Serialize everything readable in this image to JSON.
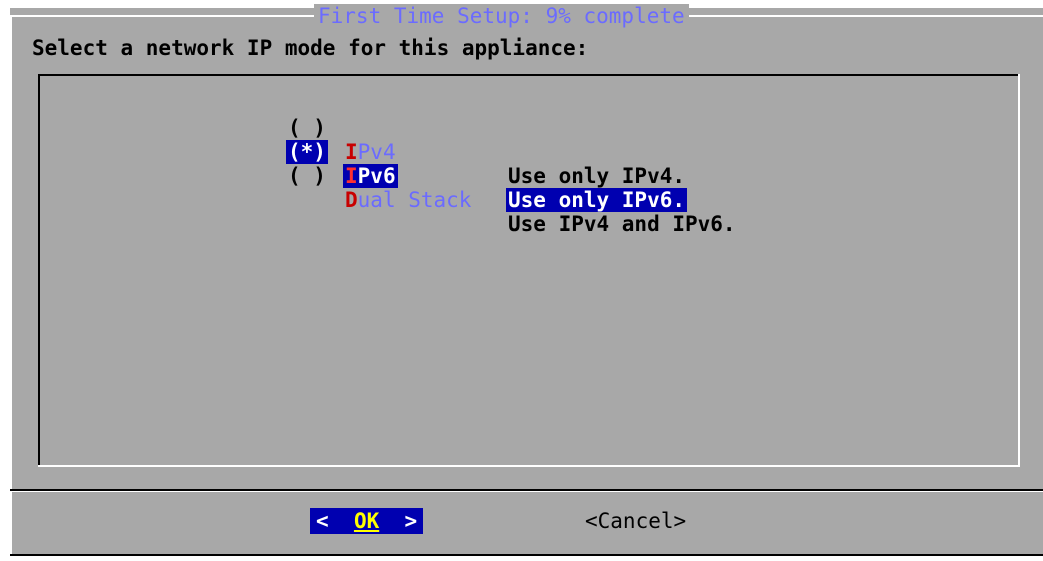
{
  "dialog": {
    "title": "First Time Setup: 9% complete",
    "prompt": "Select a network IP mode for this appliance:"
  },
  "options": [
    {
      "marker": "( )",
      "hotkey": "I",
      "rest": "Pv4",
      "description": "Use only IPv4.",
      "selected": false
    },
    {
      "marker": "(*)",
      "hotkey": "I",
      "rest": "Pv6",
      "description": "Use only IPv6.",
      "selected": true
    },
    {
      "marker": "( )",
      "hotkey": "D",
      "rest": "ual Stack",
      "description": "Use IPv4 and IPv6.",
      "selected": false
    }
  ],
  "buttons": {
    "ok_left": "<  ",
    "ok_key": "OK",
    "ok_right": "  >",
    "cancel": "<Cancel>"
  },
  "colors": {
    "dialog_bg": "#a8a8a8",
    "highlight_bg": "#0000b0",
    "title_fg": "#6b6bff",
    "hotkey_fg": "#c80000",
    "button_hotkey_fg": "#ffff00"
  }
}
